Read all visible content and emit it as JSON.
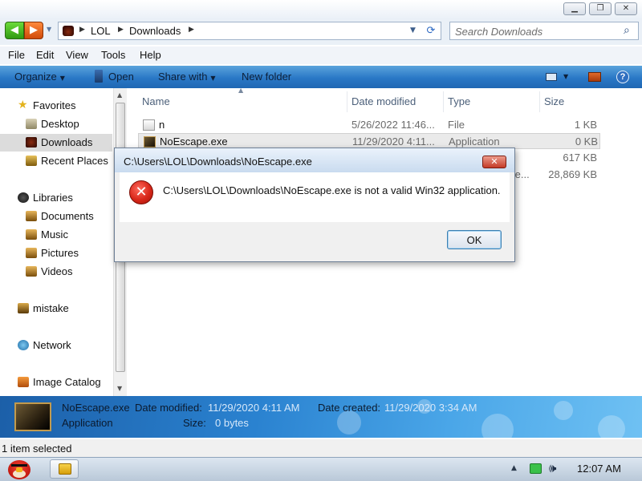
{
  "window": {
    "minimize_glyph": "▁",
    "maximize_glyph": "❐",
    "close_glyph": "✕"
  },
  "address": {
    "crumbs": [
      "LOL",
      "Downloads"
    ],
    "search_placeholder": "Search Downloads"
  },
  "menu": {
    "items": [
      "File",
      "Edit",
      "View",
      "Tools",
      "Help"
    ]
  },
  "command_bar": {
    "organize": "Organize",
    "open": "Open",
    "share_with": "Share with",
    "new_folder": "New folder",
    "help_glyph": "?"
  },
  "nav_pane": {
    "favorites": "Favorites",
    "desktop": "Desktop",
    "downloads": "Downloads",
    "recent_places": "Recent Places",
    "libraries": "Libraries",
    "documents": "Documents",
    "music": "Music",
    "pictures": "Pictures",
    "videos": "Videos",
    "mistake": "mistake",
    "network": "Network",
    "image_catalog": "Image Catalog"
  },
  "file_list": {
    "columns": {
      "name": "Name",
      "date_modified": "Date modified",
      "type": "Type",
      "size": "Size"
    },
    "rows": [
      {
        "name": "n",
        "date": "5/26/2022 11:46...",
        "type": "File",
        "size": "1 KB"
      },
      {
        "name": "NoEscape.exe",
        "date": "11/29/2020 4:11...",
        "type": "Application",
        "size": "0 KB"
      },
      {
        "name": "",
        "date": "",
        "type": "",
        "size": "617 KB"
      },
      {
        "name": "",
        "date": "",
        "type": "te...",
        "size": "28,869 KB"
      }
    ]
  },
  "details": {
    "file_name": "NoEscape.exe",
    "file_type": "Application",
    "date_modified_label": "Date modified:",
    "date_modified_value": "11/29/2020 4:11 AM",
    "date_created_label": "Date created:",
    "date_created_value": "11/29/2020 3:34 AM",
    "size_label": "Size:",
    "size_value": "0 bytes"
  },
  "status": {
    "text": "1 item selected"
  },
  "taskbar": {
    "clock": "12:07 AM",
    "tray_arrow": "▲",
    "volume_glyph": "🕪"
  },
  "dialog": {
    "title": "C:\\Users\\LOL\\Downloads\\NoEscape.exe",
    "message": "C:\\Users\\LOL\\Downloads\\NoEscape.exe is not a valid Win32 application.",
    "ok_label": "OK",
    "close_glyph": "✕",
    "error_glyph": "✕"
  },
  "colors": {
    "command_bar": "#2a78c6",
    "details_pane": "#2a82d0",
    "dialog_close": "#c43b27",
    "error_icon": "#d8271a"
  }
}
